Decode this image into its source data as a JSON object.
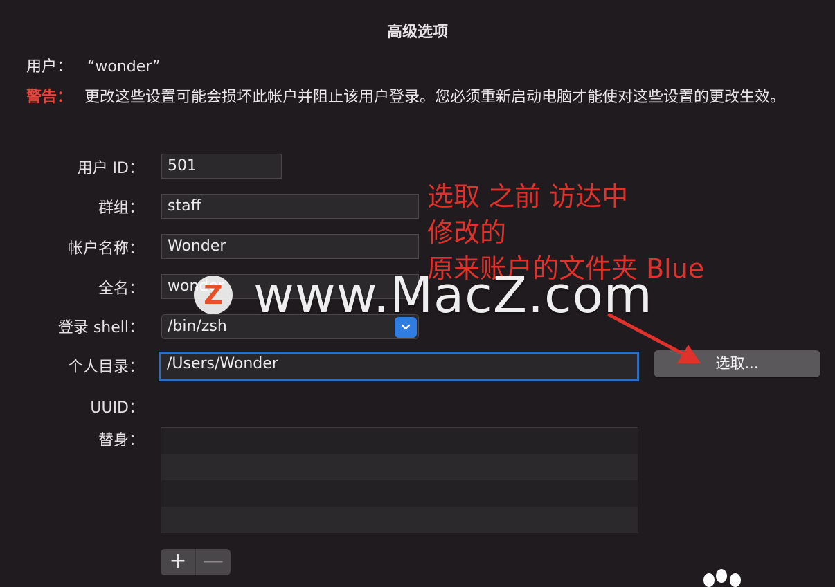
{
  "window": {
    "title": "高级选项"
  },
  "user": {
    "label": "用户：",
    "value": "“wonder”"
  },
  "warning": {
    "label": "警告：",
    "text": "更改这些设置可能会损坏此帐户并阻止该用户登录。您必须重新启动电脑才能使对这些设置的更改生效。"
  },
  "form": {
    "user_id": {
      "label": "用户 ID：",
      "value": "501"
    },
    "group": {
      "label": "群组：",
      "value": "staff"
    },
    "account_name": {
      "label": "帐户名称：",
      "value": "Wonder"
    },
    "full_name": {
      "label": "全名：",
      "value": "wonder"
    },
    "login_shell": {
      "label": "登录 shell：",
      "value": "/bin/zsh"
    },
    "home_dir": {
      "label": "个人目录：",
      "value": "/Users/Wonder",
      "choose_label": "选取..."
    },
    "uuid": {
      "label": "UUID：",
      "value": ""
    },
    "aliases": {
      "label": "替身："
    }
  },
  "alias_buttons": {
    "add": "+",
    "remove": "—"
  },
  "annotation": {
    "lines": [
      "选取 之前 访达中",
      "修改的",
      "原来账户的文件夹 Blue"
    ]
  },
  "watermark": {
    "logo": "Z",
    "text": "www.MacZ.com"
  },
  "colors": {
    "background": "#1f1b1e",
    "warning_label": "#e5463c",
    "annotation": "#e0322c",
    "focus_ring": "#2f6dbd",
    "select_arrow": "#2f7de0"
  }
}
